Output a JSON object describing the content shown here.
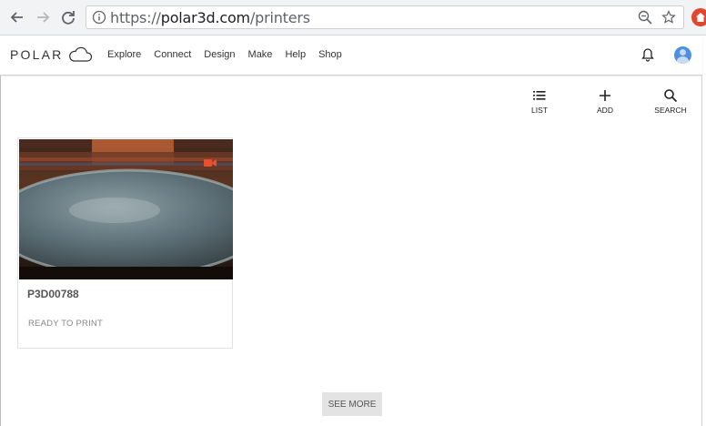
{
  "browser": {
    "url_scheme": "https://",
    "url_host": "polar3d.com",
    "url_path": "/printers"
  },
  "header": {
    "logo_text": "POLAR",
    "nav": [
      "Explore",
      "Connect",
      "Design",
      "Make",
      "Help",
      "Shop"
    ]
  },
  "toolbar": {
    "list_label": "LIST",
    "add_label": "ADD",
    "search_label": "SEARCH"
  },
  "printers": [
    {
      "name": "P3D00788",
      "status": "READY TO PRINT",
      "camera_icon": "video-camera-icon"
    }
  ],
  "see_more_label": "SEE MORE",
  "colors": {
    "camera_icon": "#e8502f",
    "avatar": "#4d8fe0",
    "accent_ext": "#e1462f"
  }
}
